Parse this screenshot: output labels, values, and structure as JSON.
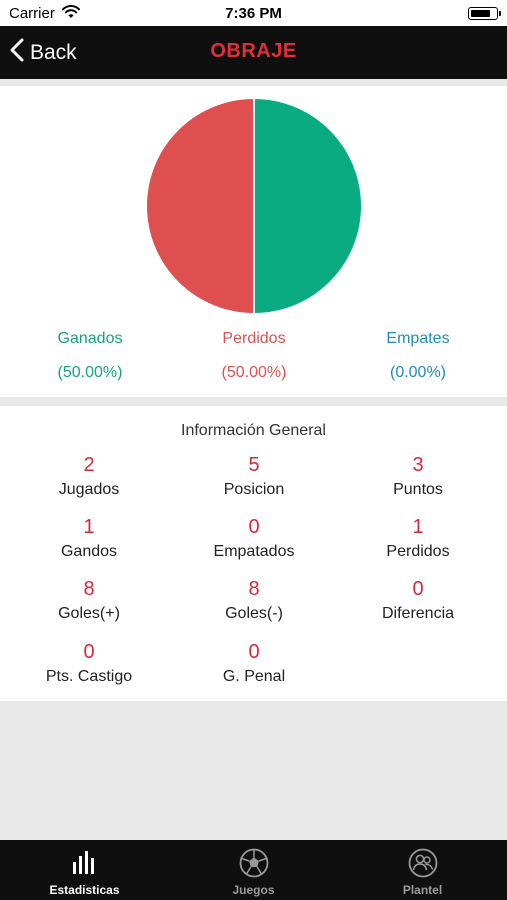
{
  "status_bar": {
    "carrier": "Carrier",
    "time": "7:36 PM"
  },
  "nav": {
    "back_label": "Back",
    "title": "OBRAJE"
  },
  "chart_data": {
    "type": "pie",
    "slices": [
      {
        "label": "Ganados",
        "value": 50.0,
        "color": "#0bab82"
      },
      {
        "label": "Perdidos",
        "value": 50.0,
        "color": "#df4f4f"
      },
      {
        "label": "Empates",
        "value": 0.0,
        "color": "#1c8fb0"
      }
    ]
  },
  "legend": [
    {
      "label": "Ganados",
      "pct": "(50.00%)",
      "color": "#14a57d"
    },
    {
      "label": "Perdidos",
      "pct": "(50.00%)",
      "color": "#e05050"
    },
    {
      "label": "Empates",
      "pct": "(0.00%)",
      "color": "#1f8fb5"
    }
  ],
  "info": {
    "heading": "Información General",
    "stats": [
      {
        "value": "2",
        "label": "Jugados"
      },
      {
        "value": "5",
        "label": "Posicion"
      },
      {
        "value": "3",
        "label": "Puntos"
      },
      {
        "value": "1",
        "label": "Gandos"
      },
      {
        "value": "0",
        "label": "Empatados"
      },
      {
        "value": "1",
        "label": "Perdidos"
      },
      {
        "value": "8",
        "label": "Goles(+)"
      },
      {
        "value": "8",
        "label": "Goles(-)"
      },
      {
        "value": "0",
        "label": "Diferencia"
      },
      {
        "value": "0",
        "label": "Pts. Castigo"
      },
      {
        "value": "0",
        "label": "G. Penal"
      }
    ]
  },
  "tabs": [
    {
      "label": "Estadisticas",
      "icon": "bar-chart-icon",
      "active": true
    },
    {
      "label": "Juegos",
      "icon": "soccer-ball-icon",
      "active": false
    },
    {
      "label": "Plantel",
      "icon": "users-icon",
      "active": false
    }
  ],
  "colors": {
    "accent": "#e02e3a",
    "value_red": "#d62a3a",
    "tab_active": "#ffffff",
    "tab_inactive": "#9a9a9a"
  }
}
